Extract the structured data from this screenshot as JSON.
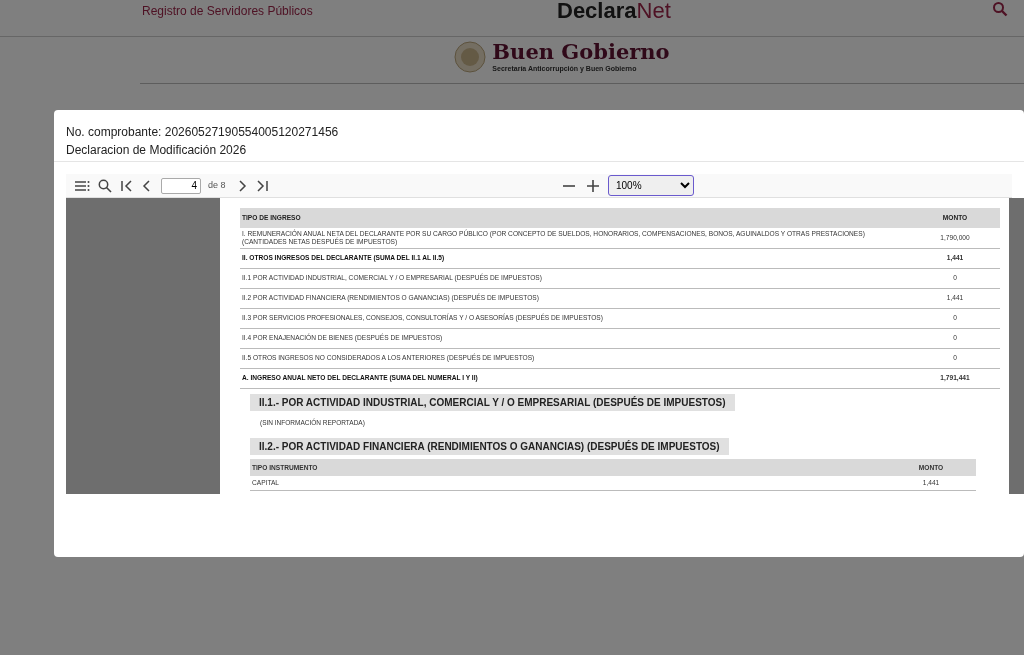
{
  "site_header": {
    "nav_link": "Registro de Servidores Públicos",
    "brand_bold": "Declara",
    "brand_light": "Net"
  },
  "institution": {
    "name": "Buen Gobierno",
    "subtitle": "Secretaría Anticorrupción y Buen Gobierno"
  },
  "modal": {
    "lines": [
      "No. comprobante: 20260527190554005120271456",
      "Declaracion de Modificación 2026"
    ],
    "viewer": {
      "page_number": "4",
      "page_total": "de 8",
      "zoom": "100%"
    },
    "document": {
      "income_table": {
        "columns": [
          "TIPO DE INGRESO",
          "MONTO"
        ],
        "rows": [
          {
            "kind": "item",
            "label": "I. REMUNERACIÓN ANUAL NETA DEL DECLARANTE POR SU CARGO PÚBLICO (POR CONCEPTO DE SUELDOS, HONORARIOS, COMPENSACIONES, BONOS, AGUINALDOS Y OTRAS PRESTACIONES) (CANTIDADES NETAS DESPUÉS DE IMPUESTOS)",
            "amount": "1,790,000"
          },
          {
            "kind": "total",
            "label": "II. OTROS INGRESOS DEL DECLARANTE (SUMA DEL II.1 AL II.5)",
            "amount": "1,441"
          },
          {
            "kind": "item",
            "label": "II.1 POR ACTIVIDAD INDUSTRIAL, COMERCIAL Y / O EMPRESARIAL (DESPUÉS DE IMPUESTOS)",
            "amount": "0"
          },
          {
            "kind": "item",
            "label": "II.2 POR ACTIVIDAD FINANCIERA (RENDIMIENTOS O GANANCIAS) (DESPUÉS DE IMPUESTOS)",
            "amount": "1,441"
          },
          {
            "kind": "item",
            "label": "II.3 POR SERVICIOS PROFESIONALES, CONSEJOS, CONSULTORÍAS Y / O ASESORÍAS (DESPUÉS DE IMPUESTOS)",
            "amount": "0"
          },
          {
            "kind": "item",
            "label": "II.4 POR ENAJENACIÓN DE BIENES (DESPUÉS DE IMPUESTOS)",
            "amount": "0"
          },
          {
            "kind": "item",
            "label": "II.5 OTROS INGRESOS NO CONSIDERADOS A LOS ANTERIORES (DESPUÉS DE IMPUESTOS)",
            "amount": "0"
          },
          {
            "kind": "total",
            "label": "A. INGRESO ANUAL NETO DEL DECLARANTE (SUMA DEL NUMERAL I Y II)",
            "amount": "1,791,441"
          }
        ]
      },
      "sections": [
        {
          "heading": "II.1.- POR ACTIVIDAD INDUSTRIAL, COMERCIAL Y / O EMPRESARIAL (DESPUÉS DE IMPUESTOS)",
          "note": "(SIN INFORMACIÓN REPORTADA)"
        },
        {
          "heading": "II.2.- POR ACTIVIDAD FINANCIERA (RENDIMIENTOS O GANANCIAS) (DESPUÉS DE IMPUESTOS)",
          "table": {
            "columns": [
              "TIPO INSTRUMENTO",
              "MONTO"
            ],
            "rows": [
              {
                "label": "CAPITAL",
                "amount": "1,441"
              }
            ]
          }
        }
      ]
    }
  }
}
